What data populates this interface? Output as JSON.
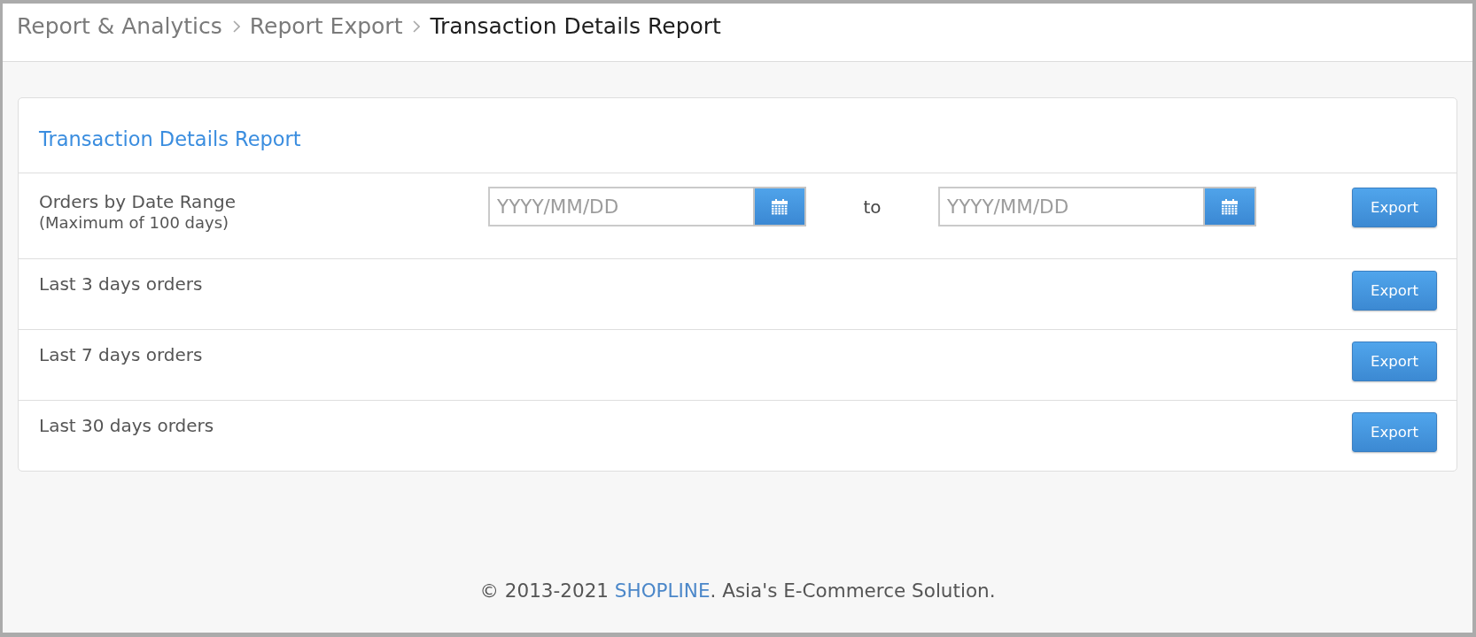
{
  "breadcrumb": [
    {
      "label": "Report & Analytics",
      "current": false
    },
    {
      "label": "Report Export",
      "current": false
    },
    {
      "label": "Transaction Details Report",
      "current": true
    }
  ],
  "card": {
    "title": "Transaction Details Report",
    "rows": [
      {
        "kind": "date_range",
        "label": "Orders by Date Range",
        "note": "(Maximum of 100 days)",
        "from": {
          "placeholder": "YYYY/MM/DD"
        },
        "separator": "to",
        "to": {
          "placeholder": "YYYY/MM/DD"
        },
        "button": "Export"
      },
      {
        "kind": "simple",
        "label": "Last 3 days orders",
        "button": "Export"
      },
      {
        "kind": "simple",
        "label": "Last 7 days orders",
        "button": "Export"
      },
      {
        "kind": "simple",
        "label": "Last 30 days orders",
        "button": "Export"
      }
    ]
  },
  "footer": {
    "prefix": "© 2013-2021",
    "brand": "SHOPLINE",
    "suffix": ". Asia's E-Commerce Solution."
  }
}
